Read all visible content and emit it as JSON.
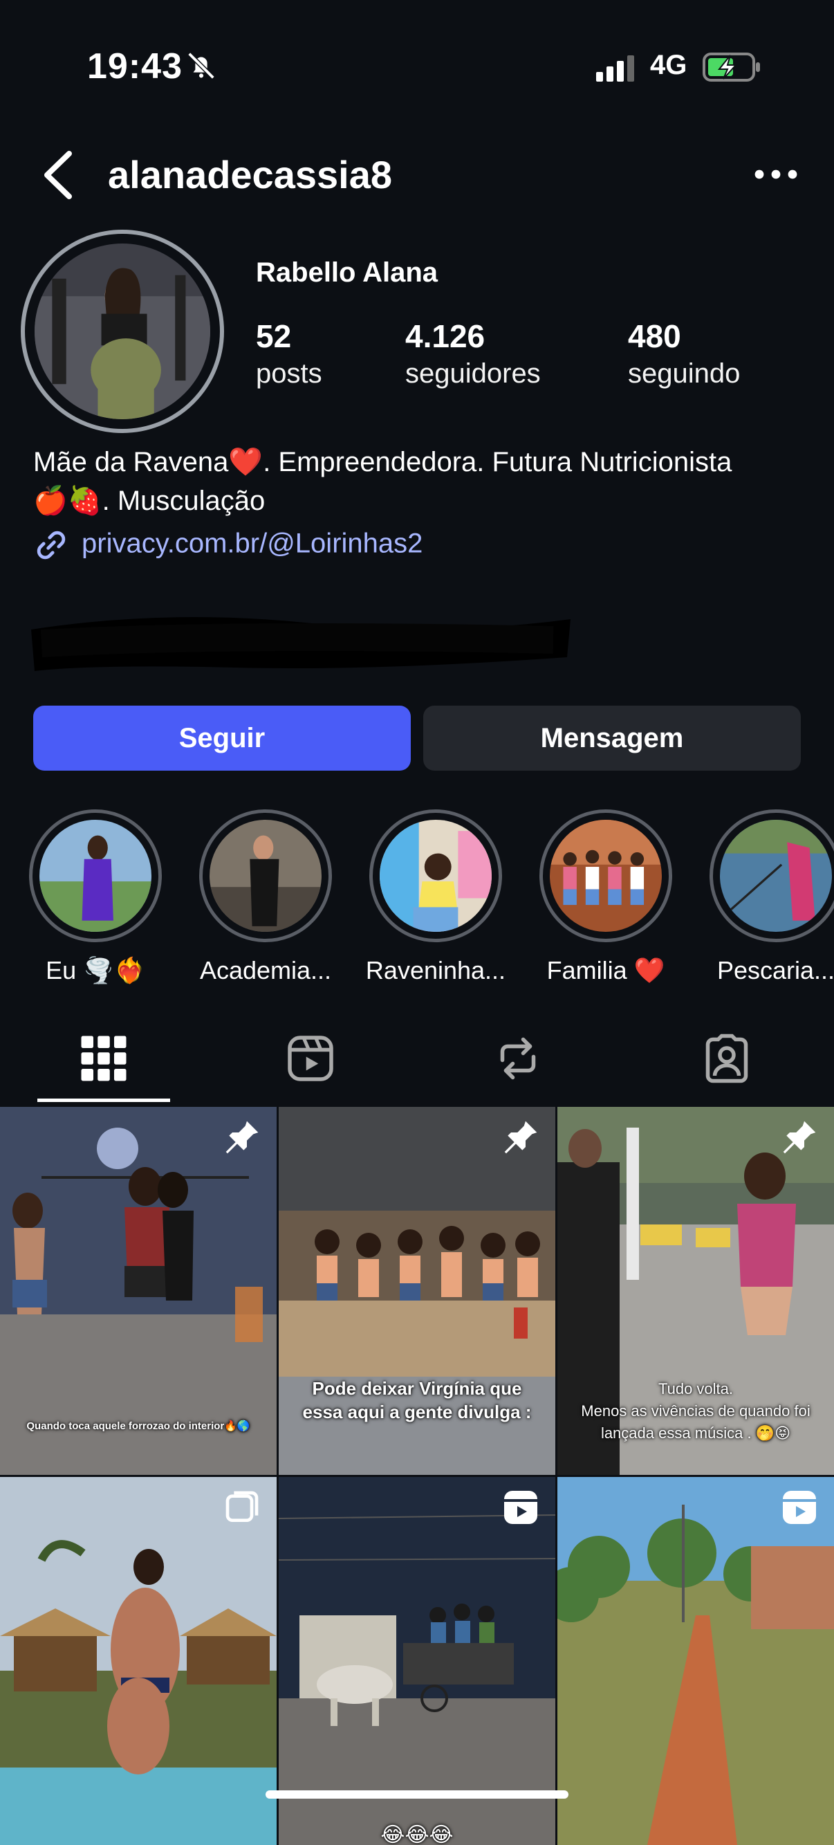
{
  "status_bar": {
    "time": "19:43",
    "network": "4G"
  },
  "header": {
    "username": "alanadecassia8"
  },
  "profile": {
    "display_name": "Rabello Alana",
    "stats": [
      {
        "value": "52",
        "label": "posts"
      },
      {
        "value": "4.126",
        "label": "seguidores"
      },
      {
        "value": "480",
        "label": "seguindo"
      }
    ],
    "bio_line1": "Mãe da Ravena❤️. Empreendedora. Futura Nutricionista",
    "bio_line2": "🍎🍓. Musculação",
    "link": "privacy.com.br/@Loirinhas2"
  },
  "actions": {
    "follow_label": "Seguir",
    "message_label": "Mensagem"
  },
  "highlights": [
    {
      "label": "Eu 🌪️❤️‍🔥"
    },
    {
      "label": "Academia..."
    },
    {
      "label": "Raveninha..."
    },
    {
      "label": "Familia ❤️"
    },
    {
      "label": "Pescaria..."
    }
  ],
  "tabs": [
    {
      "icon": "grid-icon",
      "active": true
    },
    {
      "icon": "reels-icon",
      "active": false
    },
    {
      "icon": "repost-icon",
      "active": false
    },
    {
      "icon": "tagged-icon",
      "active": false
    }
  ],
  "posts": [
    {
      "caption": "Quando toca aquele forrozao do interior🔥🌎",
      "pinned": true
    },
    {
      "caption": "Pode deixar Virgínia que essa aqui a gente divulga :",
      "pinned": true
    },
    {
      "caption_line1": "Tudo volta.",
      "caption_line2": "Menos as vivências de quando foi lançada essa música . 🤭😝",
      "pinned": true
    },
    {
      "type": "carousel"
    },
    {
      "type": "reel",
      "caption": "😂😂😂"
    },
    {
      "type": "reel"
    }
  ],
  "colors": {
    "accent": "#4a5cf7",
    "link": "#a8b7ff",
    "background": "#0c0f14"
  }
}
